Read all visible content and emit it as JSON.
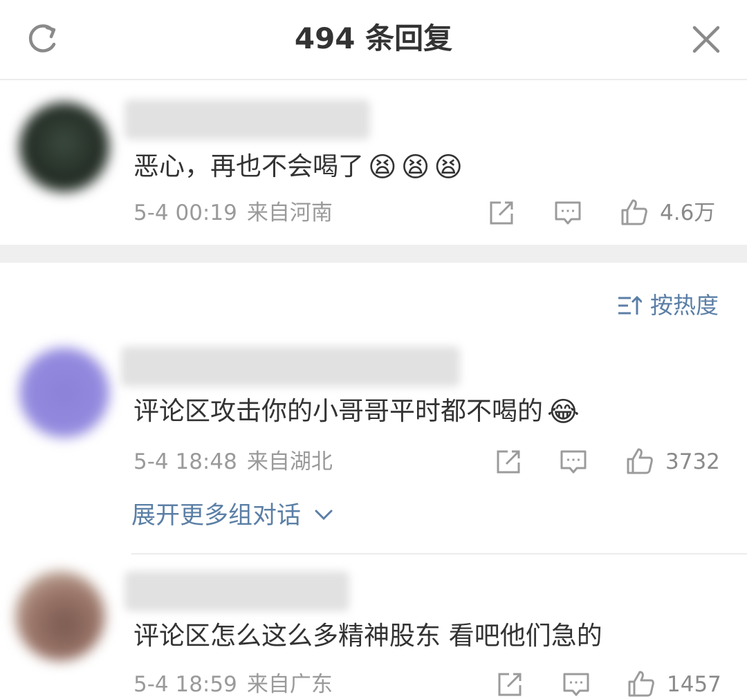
{
  "header": {
    "title": "494 条回复",
    "refresh_icon": "refresh-icon",
    "close_icon": "close-icon"
  },
  "sort": {
    "label": "按热度",
    "icon": "sort-icon"
  },
  "comments": [
    {
      "text": "恶心，再也不会喝了",
      "emojis": [
        "😫",
        "😫",
        "😫"
      ],
      "time": "5-4 00:19",
      "location": "来自河南",
      "likes": "4.6万"
    },
    {
      "text": "评论区攻击你的小哥哥平时都不喝的",
      "emojis": [
        "😂"
      ],
      "time": "5-4 18:48",
      "location": "来自湖北",
      "likes": "3732"
    },
    {
      "text": "评论区怎么这么多精神股东 看吧他们急的",
      "emojis": [],
      "time": "5-4 18:59",
      "location": "来自广东",
      "likes": "1457"
    }
  ],
  "expand": {
    "label": "展开更多组对话"
  },
  "colors": {
    "link": "#5b7fa6",
    "meta": "#9a9a9a",
    "icon": "#9b9b9b",
    "divider": "#efefef"
  }
}
